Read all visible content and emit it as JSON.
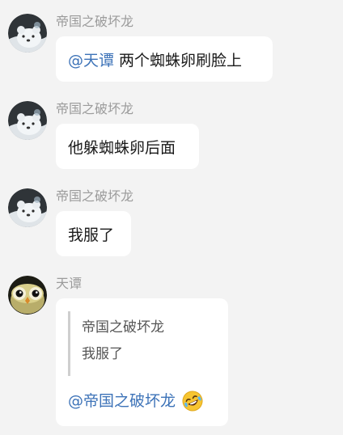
{
  "messages": [
    {
      "sender": "帝国之破坏龙",
      "avatar_icon": "bear-avatar-icon",
      "mention": "@天谭",
      "text": "两个蜘蛛卵刷脸上"
    },
    {
      "sender": "帝国之破坏龙",
      "avatar_icon": "bear-avatar-icon",
      "text": "他躲蜘蛛卵后面"
    },
    {
      "sender": "帝国之破坏龙",
      "avatar_icon": "bear-avatar-icon",
      "text": "我服了"
    },
    {
      "sender": "天谭",
      "avatar_icon": "owl-avatar-icon",
      "quote": {
        "author": "帝国之破坏龙",
        "text": "我服了"
      },
      "mention": "@帝国之破坏龙",
      "emoji": "rolling-on-floor-laughing-emoji"
    }
  ],
  "colors": {
    "background": "#f3f3f3",
    "bubble": "#ffffff",
    "mention": "#3d73b8",
    "sender_name": "#9b9b9b",
    "quote_bar": "#cfcfcf"
  }
}
